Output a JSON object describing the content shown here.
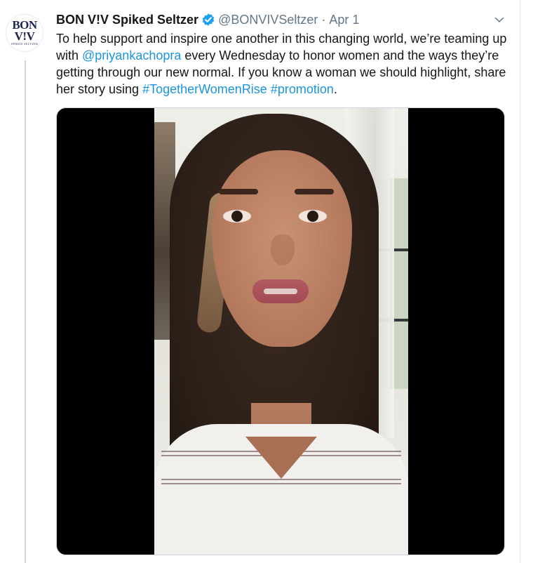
{
  "account": {
    "display_name": "BON V!V Spiked Seltzer",
    "handle": "@BONVIVSeltzer",
    "separator": "·",
    "date": "Apr 1",
    "verified": true,
    "avatar_line1": "BON",
    "avatar_line2": "V!V",
    "avatar_small_text": "SPIKED SELTZER"
  },
  "tweet": {
    "text_1": "To help support and inspire one another in this changing world, we’re teaming up with ",
    "mention": "@priyankachopra",
    "text_2": " every Wednesday to honor women and the ways they’re getting through our new normal. If you know a woman we should highlight, share her story using ",
    "hashtag_1": "#TogetherWomenRise",
    "space": " ",
    "hashtag_2": "#promotion",
    "text_3": "."
  },
  "icons": {
    "verified": "verified-badge-icon",
    "more": "chevron-down-icon"
  },
  "colors": {
    "link": "#1b95e0",
    "verified": "#1da1f2",
    "secondary_text": "#657786",
    "thread_line": "#ccd6dd"
  }
}
